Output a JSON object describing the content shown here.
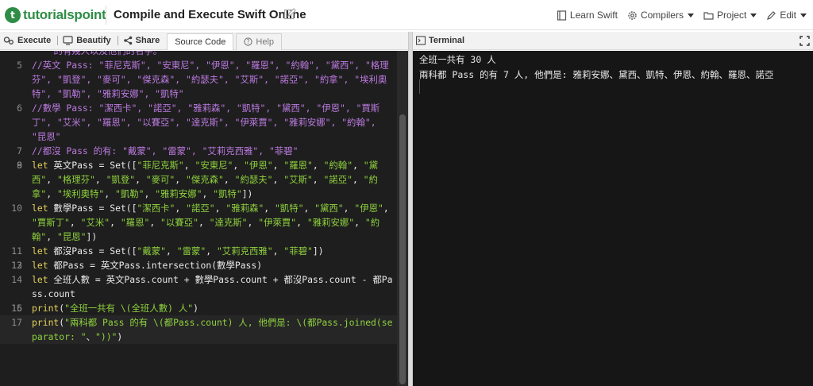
{
  "header": {
    "logo_text": "tutorialspoint",
    "page_title": "Compile and Execute Swift Online",
    "nav": [
      {
        "label": "Learn Swift",
        "icon": "book-icon",
        "dropdown": false
      },
      {
        "label": "Compilers",
        "icon": "gear-icon",
        "dropdown": true
      },
      {
        "label": "Project",
        "icon": "folder-icon",
        "dropdown": true
      },
      {
        "label": "Edit",
        "icon": "pencil-icon",
        "dropdown": true
      }
    ]
  },
  "toolbar": {
    "execute_label": "Execute",
    "beautify_label": "Beautify",
    "share_label": "Share",
    "tabs": [
      {
        "label": "Source Code",
        "active": true
      },
      {
        "label": "Help",
        "active": false
      }
    ]
  },
  "editor": {
    "lines": [
      {
        "num": "",
        "text": "    的有幾人以及他們的名字。",
        "comment": true
      },
      {
        "num": "5",
        "text": "//英文 Pass: \"菲尼克斯\", \"安東尼\", \"伊恩\", \"羅恩\", \"約翰\", \"黛西\", \"格理芬\", \"凱登\", \"麥可\", \"傑克森\", \"約瑟夫\", \"艾斯\", \"諾亞\", \"約拿\", \"埃利奧特\", \"凱勒\", \"雅莉安娜\", \"凱特\"",
        "comment": true
      },
      {
        "num": "6",
        "text": "//數學 Pass: \"潔西卡\", \"諾亞\", \"雅莉森\", \"凱特\", \"黛西\", \"伊恩\", \"賈斯丁\", \"艾米\", \"羅恩\", \"以賽亞\", \"達克斯\", \"伊萊賈\", \"雅莉安娜\", \"約翰\", \"昆恩\"",
        "comment": true
      },
      {
        "num": "7",
        "text": "//都沒 Pass 的有: \"戴蒙\", \"雷蒙\", \"艾莉克西雅\", \"菲碧\"",
        "comment": true
      },
      {
        "num": "8",
        "text": "",
        "comment": false
      },
      {
        "num": "9",
        "text": "let 英文Pass = Set([\"菲尼克斯\", \"安東尼\", \"伊恩\", \"羅恩\", \"約翰\", \"黛西\", \"格理芬\", \"凱登\", \"麥可\", \"傑克森\", \"約瑟夫\", \"艾斯\", \"諾亞\", \"約拿\", \"埃利奧特\", \"凱勒\", \"雅莉安娜\", \"凱特\"])",
        "comment": false
      },
      {
        "num": "10",
        "text": "let 數學Pass = Set([\"潔西卡\", \"諾亞\", \"雅莉森\", \"凱特\", \"黛西\", \"伊恩\", \"賈斯丁\", \"艾米\", \"羅恩\", \"以賽亞\", \"達克斯\", \"伊萊賈\", \"雅莉安娜\", \"約翰\", \"昆恩\"])",
        "comment": false
      },
      {
        "num": "11",
        "text": "let 都沒Pass = Set([\"戴蒙\", \"雷蒙\", \"艾莉克西雅\", \"菲碧\"])",
        "comment": false
      },
      {
        "num": "12",
        "text": "",
        "comment": false
      },
      {
        "num": "13",
        "text": "let 都Pass = 英文Pass.intersection(數學Pass)",
        "comment": false
      },
      {
        "num": "14",
        "text": "let 全班人數 = 英文Pass.count + 數學Pass.count + 都沒Pass.count - 都Pass.count",
        "comment": false
      },
      {
        "num": "15",
        "text": "",
        "comment": false
      },
      {
        "num": "16",
        "text": "print(\"全班一共有 \\(全班人數) 人\")",
        "comment": false
      },
      {
        "num": "17",
        "text": "print(\"兩科都 Pass 的有 \\(都Pass.count) 人, 他們是: \\(都Pass.joined(separator: \"、\"))\")",
        "comment": false,
        "active": true
      }
    ]
  },
  "terminal": {
    "title": "Terminal",
    "output": [
      "全班一共有 30 人",
      "兩科都 Pass 的有 7 人, 他們是: 雅莉安娜、黛西、凱特、伊恩、約翰、羅恩、諾亞"
    ]
  },
  "colors": {
    "brand": "#2f8d46",
    "editor_bg": "#1e1e1e",
    "comment": "#bb7ae0",
    "keyword": "#e3d05a",
    "string": "#8fd13e"
  }
}
